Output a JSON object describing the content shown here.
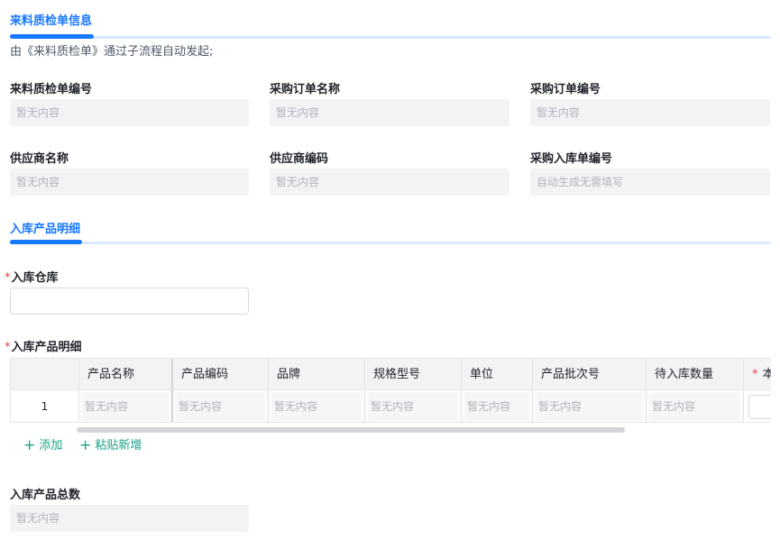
{
  "section1": {
    "title": "来料质检单信息",
    "description": "由《来料质检单》通过子流程自动发起;"
  },
  "fields": [
    {
      "label": "来料质检单编号",
      "value": "暂无内容"
    },
    {
      "label": "采购订单名称",
      "value": "暂无内容"
    },
    {
      "label": "采购订单编号",
      "value": "暂无内容"
    },
    {
      "label": "供应商名称",
      "value": "暂无内容"
    },
    {
      "label": "供应商编码",
      "value": "暂无内容"
    },
    {
      "label": "采购入库单编号",
      "value": "自动生成无需填写"
    }
  ],
  "section2": {
    "title": "入库产品明细"
  },
  "warehouse": {
    "label": "入库仓库",
    "required_mark": "*",
    "value": ""
  },
  "detail": {
    "label": "入库产品明细",
    "required_mark": "*",
    "columns": [
      "",
      "产品名称",
      "产品编码",
      "品牌",
      "规格型号",
      "单位",
      "产品批次号",
      "待入库数量",
      "本"
    ],
    "last_column_required_mark": "*",
    "rows": [
      {
        "index": "1",
        "cells": [
          "暂无内容",
          "暂无内容",
          "暂无内容",
          "暂无内容",
          "暂无内容",
          "暂无内容",
          "暂无内容"
        ]
      }
    ],
    "add_label": "添加",
    "paste_label": "粘贴新增"
  },
  "total": {
    "label": "入库产品总数",
    "value": "暂无内容"
  },
  "colors": {
    "accent": "#1677ff",
    "link": "#1aa38a",
    "required": "#f53f3f"
  }
}
